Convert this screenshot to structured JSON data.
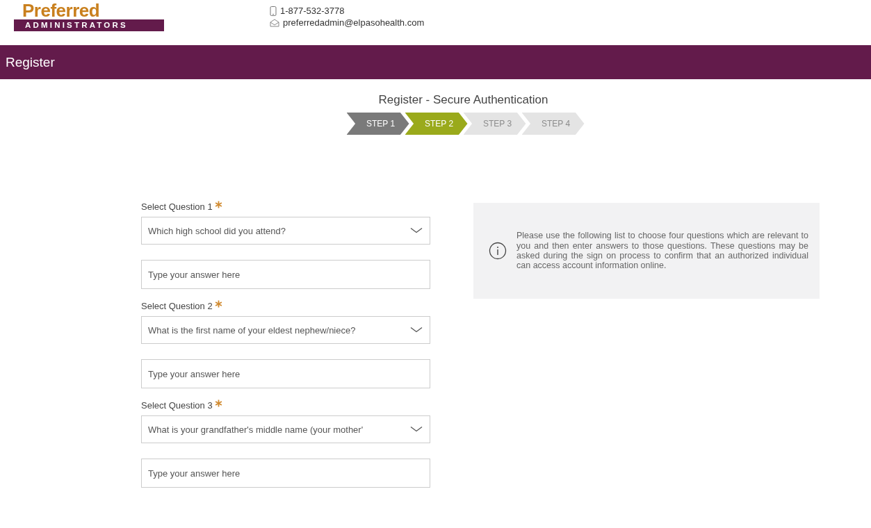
{
  "logo": {
    "word": "Preferred",
    "subword": "ADMINISTRATORS"
  },
  "contact": {
    "phone": "1-877-532-3778",
    "email": "preferredadmin@elpasohealth.com"
  },
  "page_bar": {
    "title": "Register"
  },
  "heading": "Register - Secure Authentication",
  "steps": [
    {
      "label": "STEP 1",
      "completed": true,
      "selected": false
    },
    {
      "label": "STEP 2",
      "completed": false,
      "selected": true
    },
    {
      "label": "STEP 3",
      "completed": false,
      "selected": false
    },
    {
      "label": "STEP 4",
      "completed": false,
      "selected": false
    }
  ],
  "questions": [
    {
      "label": "Select Question 1",
      "required": true,
      "value": "Which high school did you attend?",
      "answer_placeholder": "Type your answer here"
    },
    {
      "label": "Select Question 2",
      "required": true,
      "value": "What is the first name of your eldest nephew/niece?",
      "answer_placeholder": "Type your answer here"
    },
    {
      "label": "Select Question 3",
      "required": true,
      "value": "What is your grandfather's middle name (your mother'",
      "answer_placeholder": "Type your answer here"
    }
  ],
  "info": {
    "text": "Please use the following list to choose four questions which are relevant to you and then enter answers to those questions. These questions may be asked during the sign on process to confirm that an authorized individual can access account information online."
  }
}
